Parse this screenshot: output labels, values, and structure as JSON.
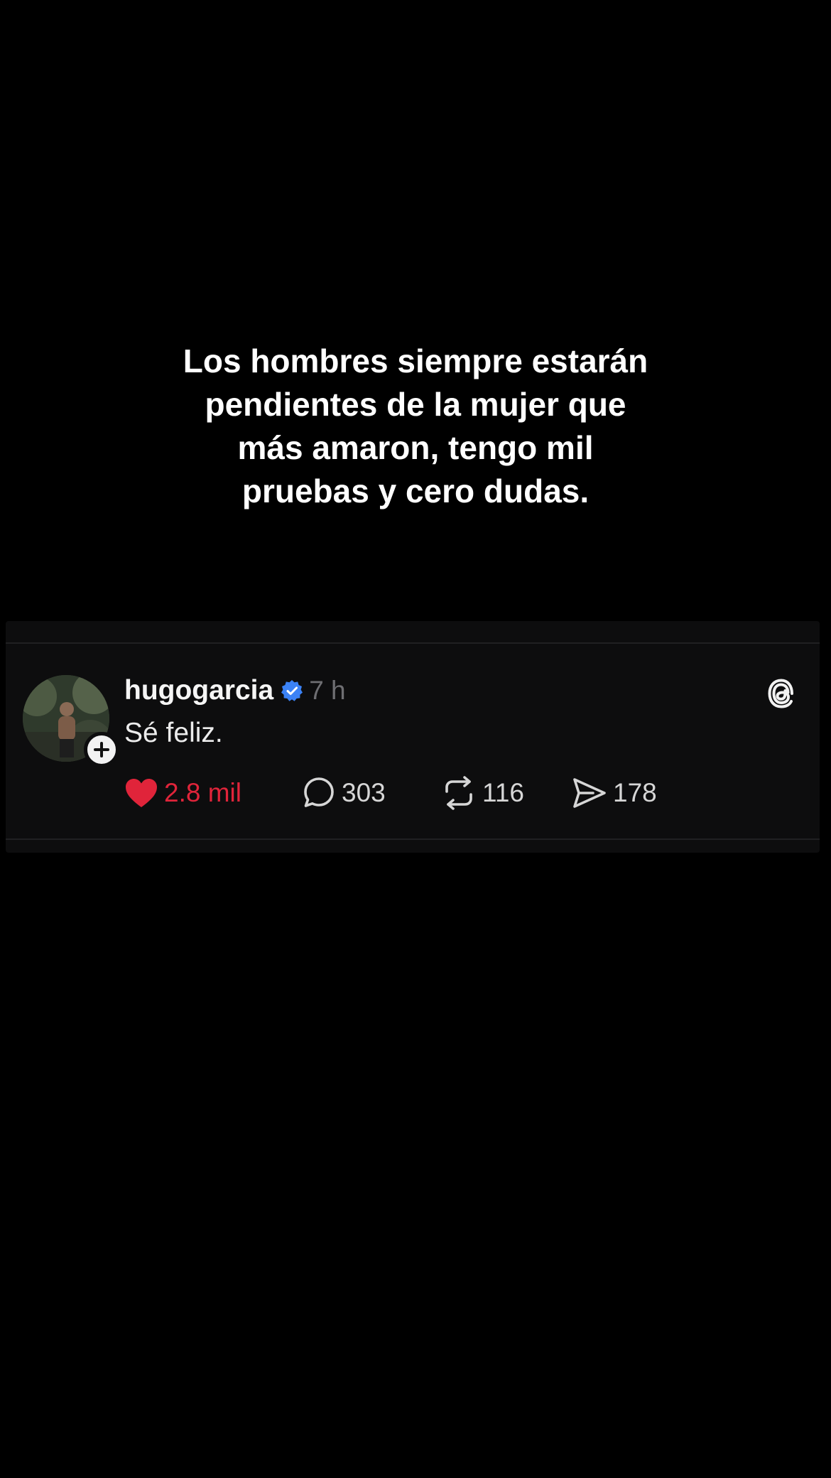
{
  "caption": {
    "lines": [
      "Los hombres siempre estarán",
      "pendientes de la mujer que",
      "más amaron, tengo mil",
      "pruebas y cero dudas."
    ]
  },
  "post": {
    "username": "hugogarcia",
    "verified": true,
    "timestamp": "7 h",
    "text": "Sé feliz.",
    "likes": "2.8 mil",
    "replies": "303",
    "reposts": "116",
    "shares": "178",
    "liked": true
  },
  "icons": {
    "like": "heart-icon",
    "reply": "speech-bubble-icon",
    "repost": "repost-icon",
    "share": "send-icon",
    "verified": "verified-badge-icon",
    "app": "threads-logo-icon",
    "follow": "plus-icon"
  },
  "colors": {
    "background": "#000000",
    "card": "#0d0d0e",
    "like": "#e0243a",
    "verified": "#3b82f6",
    "muted": "#6e6e72"
  }
}
